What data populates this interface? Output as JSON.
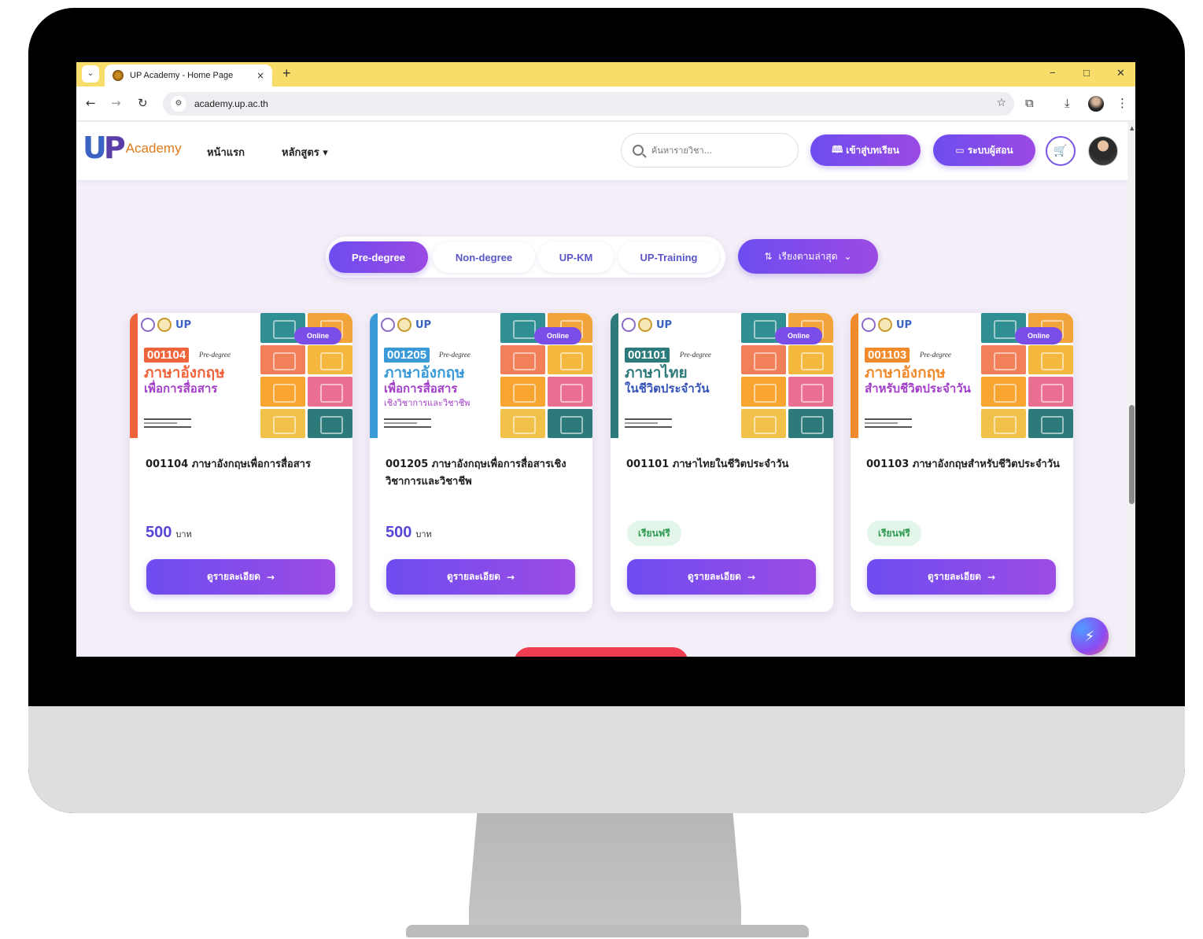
{
  "browser": {
    "tab_title": "UP Academy - Home Page",
    "tab_close": "×",
    "new_tab": "+",
    "url": "academy.up.ac.th",
    "win_min": "−",
    "win_max": "□",
    "win_close": "✕"
  },
  "header": {
    "logo_text": "Academy",
    "nav": [
      {
        "label": "หน้าแรก"
      },
      {
        "label": "หลักสูตร ▾"
      }
    ],
    "search_placeholder": "ค้นหารายวิชา...",
    "enter_lessons": "เข้าสู่บทเรียน",
    "instructor_system": "ระบบผู้สอน"
  },
  "filters": {
    "tabs": [
      {
        "label": "Pre-degree",
        "active": true
      },
      {
        "label": "Non-degree",
        "active": false
      },
      {
        "label": "UP-KM",
        "active": false
      },
      {
        "label": "UP-Training",
        "active": false
      }
    ],
    "sort_label": "เรียงตามล่าสุด"
  },
  "courses": [
    {
      "code": "001104",
      "level": "Pre-degree",
      "badge": "Online",
      "thumb_line1": "ภาษาอังกฤษ",
      "thumb_line2": "เพื่อการสื่อสาร",
      "thumb_line3": "",
      "title": "001104 ภาษาอังกฤษเพื่อการสื่อสาร",
      "price": "500",
      "price_unit": "บาท",
      "free_label": "",
      "button": "ดูรายละเอียด",
      "accent": "#f0643c"
    },
    {
      "code": "001205",
      "level": "Pre-degree",
      "badge": "Online",
      "thumb_line1": "ภาษาอังกฤษ",
      "thumb_line2": "เพื่อการสื่อสาร",
      "thumb_line3": "เชิงวิชาการและวิชาชีพ",
      "title": "001205 ภาษาอังกฤษเพื่อการสื่อสารเชิงวิชาการและวิชาชีพ",
      "price": "500",
      "price_unit": "บาท",
      "free_label": "",
      "button": "ดูรายละเอียด",
      "accent": "#3a9ad8"
    },
    {
      "code": "001101",
      "level": "Pre-degree",
      "badge": "Online",
      "thumb_line1": "ภาษาไทย",
      "thumb_line2": "ในชีวิตประจำวัน",
      "thumb_line3": "",
      "title": "001101 ภาษาไทยในชีวิตประจำวัน",
      "price": "",
      "price_unit": "",
      "free_label": "เรียนฟรี",
      "button": "ดูรายละเอียด",
      "accent": "#2d7a7a"
    },
    {
      "code": "001103",
      "level": "Pre-degree",
      "badge": "Online",
      "thumb_line1": "ภาษาอังกฤษ",
      "thumb_line2": "สำหรับชีวิตประจำวัน",
      "thumb_line3": "",
      "title": "001103 ภาษาอังกฤษสำหรับชีวิตประจำวัน",
      "price": "",
      "price_unit": "",
      "free_label": "เรียนฟรี",
      "button": "ดูรายละเอียด",
      "accent": "#f08a2a"
    }
  ],
  "colors": {
    "primary": "#6d4cf0",
    "primary_end": "#9b4ae3",
    "free_bg": "#e4f6e9",
    "free_text": "#2f9b52",
    "browser_tabbar": "#f8dd6a",
    "page_bg": "#f3eef7"
  }
}
